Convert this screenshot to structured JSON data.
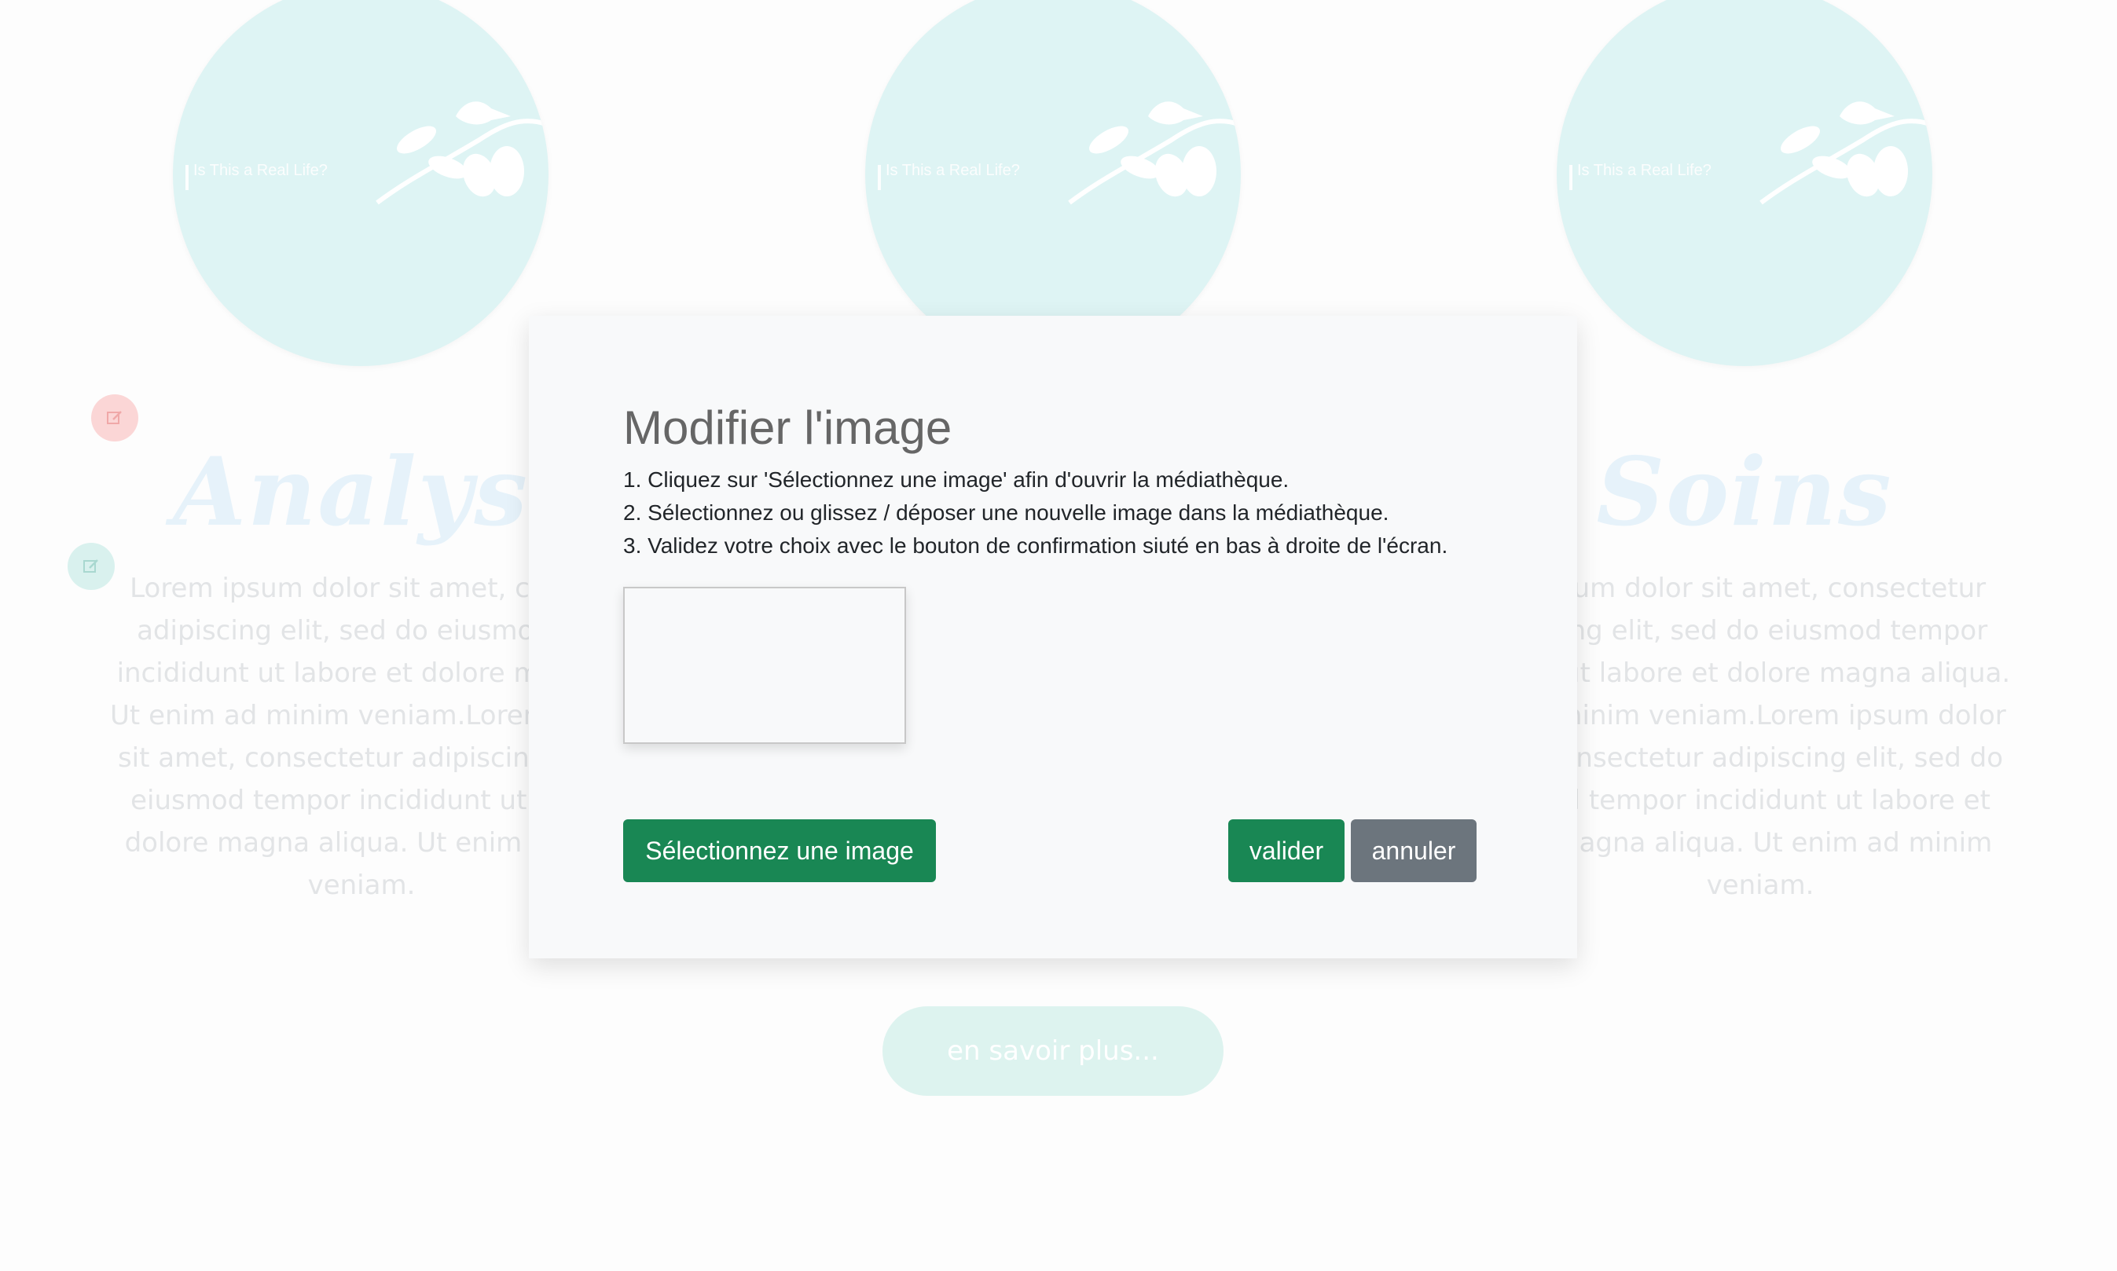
{
  "background": {
    "circle_caption": "Is This a Real Life?",
    "columns": [
      {
        "title": "Analyse",
        "text": "Lorem ipsum dolor sit amet, conse\nadipiscing elit, sed do eiusmod te\nincididunt ut labore et dolore magna\nUt enim ad minim veniam.Lorem ipsu\nsit amet, consectetur adipiscing elit,\neiusmod tempor incididunt ut labo\ndolore magna aliqua. Ut enim ad m\nveniam."
      },
      {
        "title": "Soins",
        "text": "ipsum dolor sit amet, consectetur\nscing elit, sed do eiusmod tempor\nunt ut labore et dolore magna aliqua.\nad minim veniam.Lorem ipsum dolor\nt, consectetur adipiscing elit, sed do\nnod tempor incididunt ut labore et\ne magna aliqua. Ut enim ad minim\nveniam."
      }
    ],
    "more_button": "en savoir plus..."
  },
  "modal": {
    "title": "Modifier l'image",
    "instructions": [
      "1. Cliquez sur 'Sélectionnez une image' afin d'ouvrir la médiathèque.",
      "2. Sélectionnez ou glissez / déposer une nouvelle image dans la médiathèque.",
      "3. Validez votre choix avec le bouton de confirmation siuté en bas à droite de l'écran."
    ],
    "select_button": "Sélectionnez une image",
    "confirm_button": "valider",
    "cancel_button": "annuler"
  },
  "colors": {
    "primary_green": "#198754",
    "secondary_gray": "#6c757d",
    "circle_teal": "#def4f4"
  }
}
